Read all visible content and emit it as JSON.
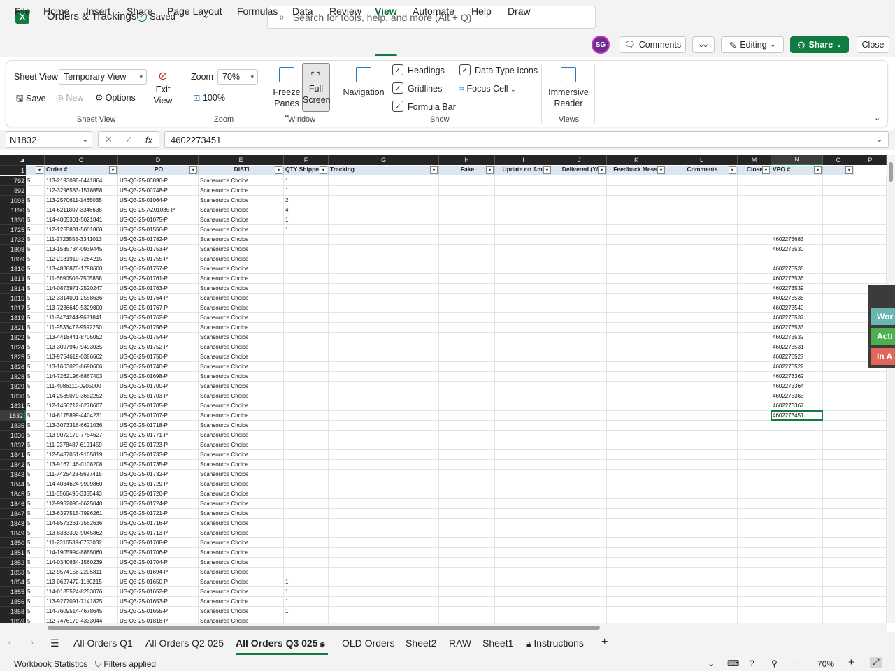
{
  "app": {
    "logo": "X",
    "doc_title": "Orders & Trackings",
    "saved": "Saved"
  },
  "search": {
    "placeholder": "Search for tools, help, and more (Alt + Q)"
  },
  "menu": [
    "File",
    "Home",
    "Insert",
    "Share",
    "Page Layout",
    "Formulas",
    "Data",
    "Review",
    "View",
    "Automate",
    "Help",
    "Draw"
  ],
  "menu_active": "View",
  "user": {
    "initials": "SG"
  },
  "top_buttons": {
    "comments": "Comments",
    "editing": "Editing",
    "share": "Share",
    "close": "Close"
  },
  "ribbon": {
    "sheet_view_label": "Sheet View",
    "sheet_view_value": "Temporary View",
    "save": "Save",
    "new": "New",
    "options": "Options",
    "exit_view": [
      "Exit",
      "View"
    ],
    "zoom_label": "Zoom",
    "zoom_value": "70%",
    "zoom_100": "100%",
    "freeze_panes": [
      "Freeze",
      "Panes"
    ],
    "full_screen": [
      "Full",
      "Screen"
    ],
    "navigation": "Navigation",
    "headings": "Headings",
    "gridlines": "Gridlines",
    "formula_bar": "Formula Bar",
    "data_type_icons": "Data Type Icons",
    "focus_cell": "Focus Cell",
    "immersive_reader": [
      "Immersive",
      "Reader"
    ],
    "groups": {
      "sheet_view": "Sheet View",
      "zoom": "Zoom",
      "window": "Window",
      "show": "Show",
      "views": "Views"
    }
  },
  "formula_bar": {
    "name_box": "N1832",
    "value": "4602273451",
    "fx": "fx"
  },
  "sheet": {
    "columns": [
      {
        "letter": "",
        "header": ""
      },
      {
        "letter": "C",
        "header": "Order #"
      },
      {
        "letter": "D",
        "header": "PO"
      },
      {
        "letter": "E",
        "header": "DISTI"
      },
      {
        "letter": "F",
        "header": "QTY Shippe"
      },
      {
        "letter": "G",
        "header": "Tracking"
      },
      {
        "letter": "H",
        "header": "Fake"
      },
      {
        "letter": "I",
        "header": "Update on Ama"
      },
      {
        "letter": "J",
        "header": "Delivered (Y/"
      },
      {
        "letter": "K",
        "header": "Feedback Messa"
      },
      {
        "letter": "L",
        "header": "Comments"
      },
      {
        "letter": "M",
        "header": "Close"
      },
      {
        "letter": "N",
        "header": "VPO #"
      },
      {
        "letter": "O",
        "header": ""
      },
      {
        "letter": "P",
        "header": ""
      }
    ],
    "header_row_number": "1",
    "rows": [
      {
        "n": "792",
        "b": "5",
        "order": "113-2193096-6441864",
        "po": "US-Q3-25-00890-P",
        "disti": "Scansource Choice",
        "qty": "1",
        "vpo": ""
      },
      {
        "n": "892",
        "b": "",
        "order": "112-3296583-1578658",
        "po": "US-Q3-25-00748-P",
        "disti": "Scansource Choice",
        "qty": "1",
        "vpo": ""
      },
      {
        "n": "1093",
        "b": "5",
        "order": "113-2570611-1465035",
        "po": "US-Q3-25-01064-P",
        "disti": "Scansource Choice",
        "qty": "2",
        "vpo": ""
      },
      {
        "n": "1190",
        "b": "5",
        "order": "114-6211807-3346638",
        "po": "US-Q3-25-AZ01035-P",
        "disti": "Scansource Choice",
        "qty": "4",
        "vpo": ""
      },
      {
        "n": "1330",
        "b": "5",
        "order": "114-4005301-5021841",
        "po": "US-Q3-25-01075-P",
        "disti": "Scansource Choice",
        "qty": "1",
        "vpo": ""
      },
      {
        "n": "1725",
        "b": "5",
        "order": "112-1255831-5001860",
        "po": "US-Q3-25-01556-P",
        "disti": "Scansource Choice",
        "qty": "1",
        "vpo": ""
      },
      {
        "n": "1732",
        "b": "5",
        "order": "111-2723555-3341013",
        "po": "US-Q3-25-01782-P",
        "disti": "Scansource Choice",
        "qty": "",
        "vpo": "4602273683"
      },
      {
        "n": "1808",
        "b": "5",
        "order": "113-1585734-0939445",
        "po": "US-Q3-25-01753-P",
        "disti": "Scansource Choice",
        "qty": "",
        "vpo": "4602273530"
      },
      {
        "n": "1809",
        "b": "5",
        "order": "112-2181910-7264215",
        "po": "US-Q3-25-01755-P",
        "disti": "Scansource Choice",
        "qty": "",
        "vpo": ""
      },
      {
        "n": "1810",
        "b": "5",
        "order": "113-4838870-1798600",
        "po": "US-Q3-25-01757-P",
        "disti": "Scansource Choice",
        "qty": "",
        "vpo": "4602273535"
      },
      {
        "n": "1813",
        "b": "5",
        "order": "111-6690505-7505856",
        "po": "US-Q3-25-01761-P",
        "disti": "Scansource Choice",
        "qty": "",
        "vpo": "4602273536"
      },
      {
        "n": "1814",
        "b": "5",
        "order": "114-0873971-2520247",
        "po": "US-Q3-25-01763-P",
        "disti": "Scansource Choice",
        "qty": "",
        "vpo": "4602273539"
      },
      {
        "n": "1815",
        "b": "5",
        "order": "112-3314001-2558636",
        "po": "US-Q3-25-01764-P",
        "disti": "Scansource Choice",
        "qty": "",
        "vpo": "4602273538"
      },
      {
        "n": "1817",
        "b": "5",
        "order": "113-7236649-5329800",
        "po": "US-Q3-25-01767-P",
        "disti": "Scansource Choice",
        "qty": "",
        "vpo": "4602273540"
      },
      {
        "n": "1819",
        "b": "5",
        "order": "111-9474244-9681841",
        "po": "US-Q3-25-01762-P",
        "disti": "Scansource Choice",
        "qty": "",
        "vpo": "4602273537"
      },
      {
        "n": "1821",
        "b": "5",
        "order": "111-9533472-9592250",
        "po": "US-Q3-25-01756-P",
        "disti": "Scansource Choice",
        "qty": "",
        "vpo": "4602273533"
      },
      {
        "n": "1822",
        "b": "5",
        "order": "113-4418441-8705052",
        "po": "US-Q3-25-01754-P",
        "disti": "Scansource Choice",
        "qty": "",
        "vpo": "4602273532"
      },
      {
        "n": "1824",
        "b": "5",
        "order": "113-3097947-9493035",
        "po": "US-Q3-25-01752-P",
        "disti": "Scansource Choice",
        "qty": "",
        "vpo": "4602273531"
      },
      {
        "n": "1825",
        "b": "5",
        "order": "113-9754619-0386662",
        "po": "US-Q3-25-01750-P",
        "disti": "Scansource Choice",
        "qty": "",
        "vpo": "4602273527"
      },
      {
        "n": "1826",
        "b": "5",
        "order": "113-1663023-8690606",
        "po": "US-Q3-25-01740-P",
        "disti": "Scansource Choice",
        "qty": "",
        "vpo": "4602273522"
      },
      {
        "n": "1828",
        "b": "5",
        "order": "114-7262196-6867403",
        "po": "US-Q3-25-01698-P",
        "disti": "Scansource Choice",
        "qty": "",
        "vpo": "4602273362"
      },
      {
        "n": "1829",
        "b": "5",
        "order": "111-4086111-0905000",
        "po": "US-Q3-25-01700-P",
        "disti": "Scansource Choice",
        "qty": "",
        "vpo": "4602273364"
      },
      {
        "n": "1830",
        "b": "5",
        "order": "114-2535079-3652252",
        "po": "US-Q3-25-01703-P",
        "disti": "Scansource Choice",
        "qty": "",
        "vpo": "4602273363"
      },
      {
        "n": "1831",
        "b": "5",
        "order": "112-1456212-6278607",
        "po": "US-Q3-25-01705-P",
        "disti": "Scansource Choice",
        "qty": "",
        "vpo": "4602273367"
      },
      {
        "n": "1832",
        "b": "5",
        "order": "114-8175899-4404231",
        "po": "US-Q3-25-01707-P",
        "disti": "Scansource Choice",
        "qty": "",
        "vpo": "4602273451"
      },
      {
        "n": "1835",
        "b": "5",
        "order": "113-3073316-6621036",
        "po": "US-Q3-25-01718-P",
        "disti": "Scansource Choice",
        "qty": "",
        "vpo": ""
      },
      {
        "n": "1836",
        "b": "5",
        "order": "113-9072179-7754627",
        "po": "US-Q3-25-01771-P",
        "disti": "Scansource Choice",
        "qty": "",
        "vpo": ""
      },
      {
        "n": "1837",
        "b": "5",
        "order": "111-9378487-6191459",
        "po": "US-Q3-25-01723-P",
        "disti": "Scansource Choice",
        "qty": "",
        "vpo": ""
      },
      {
        "n": "1841",
        "b": "5",
        "order": "112-5487051-9105819",
        "po": "US-Q3-25-01733-P",
        "disti": "Scansource Choice",
        "qty": "",
        "vpo": ""
      },
      {
        "n": "1842",
        "b": "5",
        "order": "113-9167146-0108208",
        "po": "US-Q3-25-01735-P",
        "disti": "Scansource Choice",
        "qty": "",
        "vpo": ""
      },
      {
        "n": "1843",
        "b": "5",
        "order": "111-7425423-5627415",
        "po": "US-Q3-25-01732-P",
        "disti": "Scansource Choice",
        "qty": "",
        "vpo": ""
      },
      {
        "n": "1844",
        "b": "5",
        "order": "114-4034624-9909860",
        "po": "US-Q3-25-01729-P",
        "disti": "Scansource Choice",
        "qty": "",
        "vpo": ""
      },
      {
        "n": "1845",
        "b": "5",
        "order": "111-6566496-3355443",
        "po": "US-Q3-25-01726-P",
        "disti": "Scansource Choice",
        "qty": "",
        "vpo": ""
      },
      {
        "n": "1846",
        "b": "5",
        "order": "112-9952090-6625040",
        "po": "US-Q3-25-01724-P",
        "disti": "Scansource Choice",
        "qty": "",
        "vpo": ""
      },
      {
        "n": "1847",
        "b": "5",
        "order": "113-6397515-7996261",
        "po": "US-Q3-25-01721-P",
        "disti": "Scansource Choice",
        "qty": "",
        "vpo": ""
      },
      {
        "n": "1848",
        "b": "5",
        "order": "114-8573261-3562636",
        "po": "US-Q3-25-01716-P",
        "disti": "Scansource Choice",
        "qty": "",
        "vpo": ""
      },
      {
        "n": "1849",
        "b": "5",
        "order": "113-8333303-9045862",
        "po": "US-Q3-25-01713-P",
        "disti": "Scansource Choice",
        "qty": "",
        "vpo": ""
      },
      {
        "n": "1850",
        "b": "5",
        "order": "111-2316539-6753032",
        "po": "US-Q3-25-01708-P",
        "disti": "Scansource Choice",
        "qty": "",
        "vpo": ""
      },
      {
        "n": "1851",
        "b": "5",
        "order": "114-1905994-8885060",
        "po": "US-Q3-25-01706-P",
        "disti": "Scansource Choice",
        "qty": "",
        "vpo": ""
      },
      {
        "n": "1852",
        "b": "5",
        "order": "114-0340634-1560239",
        "po": "US-Q3-25-01704-P",
        "disti": "Scansource Choice",
        "qty": "",
        "vpo": ""
      },
      {
        "n": "1853",
        "b": "5",
        "order": "112-9574158-2205811",
        "po": "US-Q3-25-01694-P",
        "disti": "Scansource Choice",
        "qty": "",
        "vpo": ""
      },
      {
        "n": "1854",
        "b": "5",
        "order": "113-0627472-1180215",
        "po": "US-Q3-25-01650-P",
        "disti": "Scansource Choice",
        "qty": "1",
        "vpo": ""
      },
      {
        "n": "1855",
        "b": "5",
        "order": "114-0185524-8253076",
        "po": "US-Q3-25-01652-P",
        "disti": "Scansource Choice",
        "qty": "1",
        "vpo": ""
      },
      {
        "n": "1856",
        "b": "5",
        "order": "113-9277091-7141825",
        "po": "US-Q3-25-01653-P",
        "disti": "Scansource Choice",
        "qty": "1",
        "vpo": ""
      },
      {
        "n": "1858",
        "b": "5",
        "order": "114-7609514-4678645",
        "po": "US-Q3-25-01655-P",
        "disti": "Scansource Choice",
        "qty": "1",
        "vpo": ""
      },
      {
        "n": "1859",
        "b": "5",
        "order": "112-7476179-4333044",
        "po": "US-Q3-25-01818-P",
        "disti": "Scansource Choice",
        "qty": "",
        "vpo": ""
      }
    ],
    "selected_row": "1832",
    "selected_column": "N"
  },
  "side_panel": [
    {
      "label": "Wor",
      "color": "#69b7b0"
    },
    {
      "label": "Acti",
      "color": "#4caf50"
    },
    {
      "label": "In A",
      "color": "#e0685a"
    }
  ],
  "tabs": [
    "All Orders Q1",
    "All Orders Q2 025",
    "All Orders Q3 025",
    "OLD Orders",
    "Sheet2",
    "RAW",
    "Sheet1",
    "Instructions"
  ],
  "tab_active": "All Orders Q3 025",
  "status": {
    "workbook_statistics": "Workbook Statistics",
    "filters": "Filters applied",
    "zoom": "70%"
  },
  "colors": {
    "accent": "#107c41",
    "header_fill": "#dce6f1",
    "headings_bg": "#252525"
  }
}
